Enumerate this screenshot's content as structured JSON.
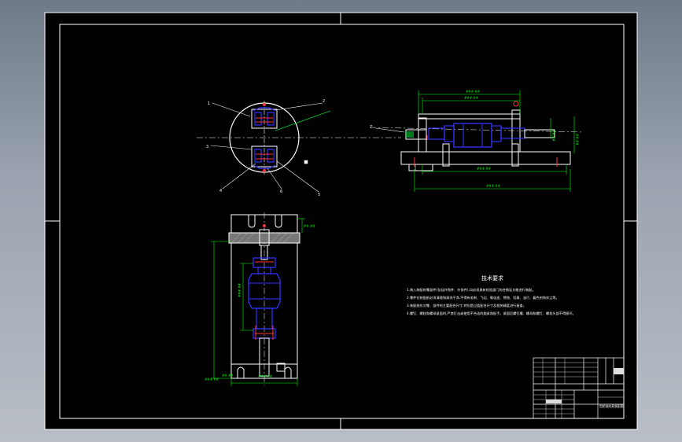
{
  "drawing": {
    "notes_title": "技术要求",
    "notes": [
      "1.装入装配的零部件(包括外购件、外协件),均必须具有检验部门的合格证方能进行装配。",
      "2.零件在装配前必须清理和清洗干净,不得有毛刺、飞边、氧化皮、锈蚀、切屑、油污、着色剂和灰尘等。",
      "3.装配前应对零、部件的主要配合尺寸,特别是过盈配合尺寸及相关精度进行复查。",
      "4.螺钉、螺栓和螺母紧固时,严禁打击或使用不合适的旋具和扳手。紧固后螺钉槽、螺母和螺钉、螺栓头部不得损坏。"
    ],
    "title_block": {
      "part_name": "齿轮轴夹具装配图"
    },
    "colors": {
      "background": "#000000",
      "frame": "#ffffff",
      "part": "#ffffff",
      "highlight": "#3333ff",
      "dimension": "#00ff00",
      "section": "#ff3333",
      "leader": "#00cc33"
    }
  }
}
